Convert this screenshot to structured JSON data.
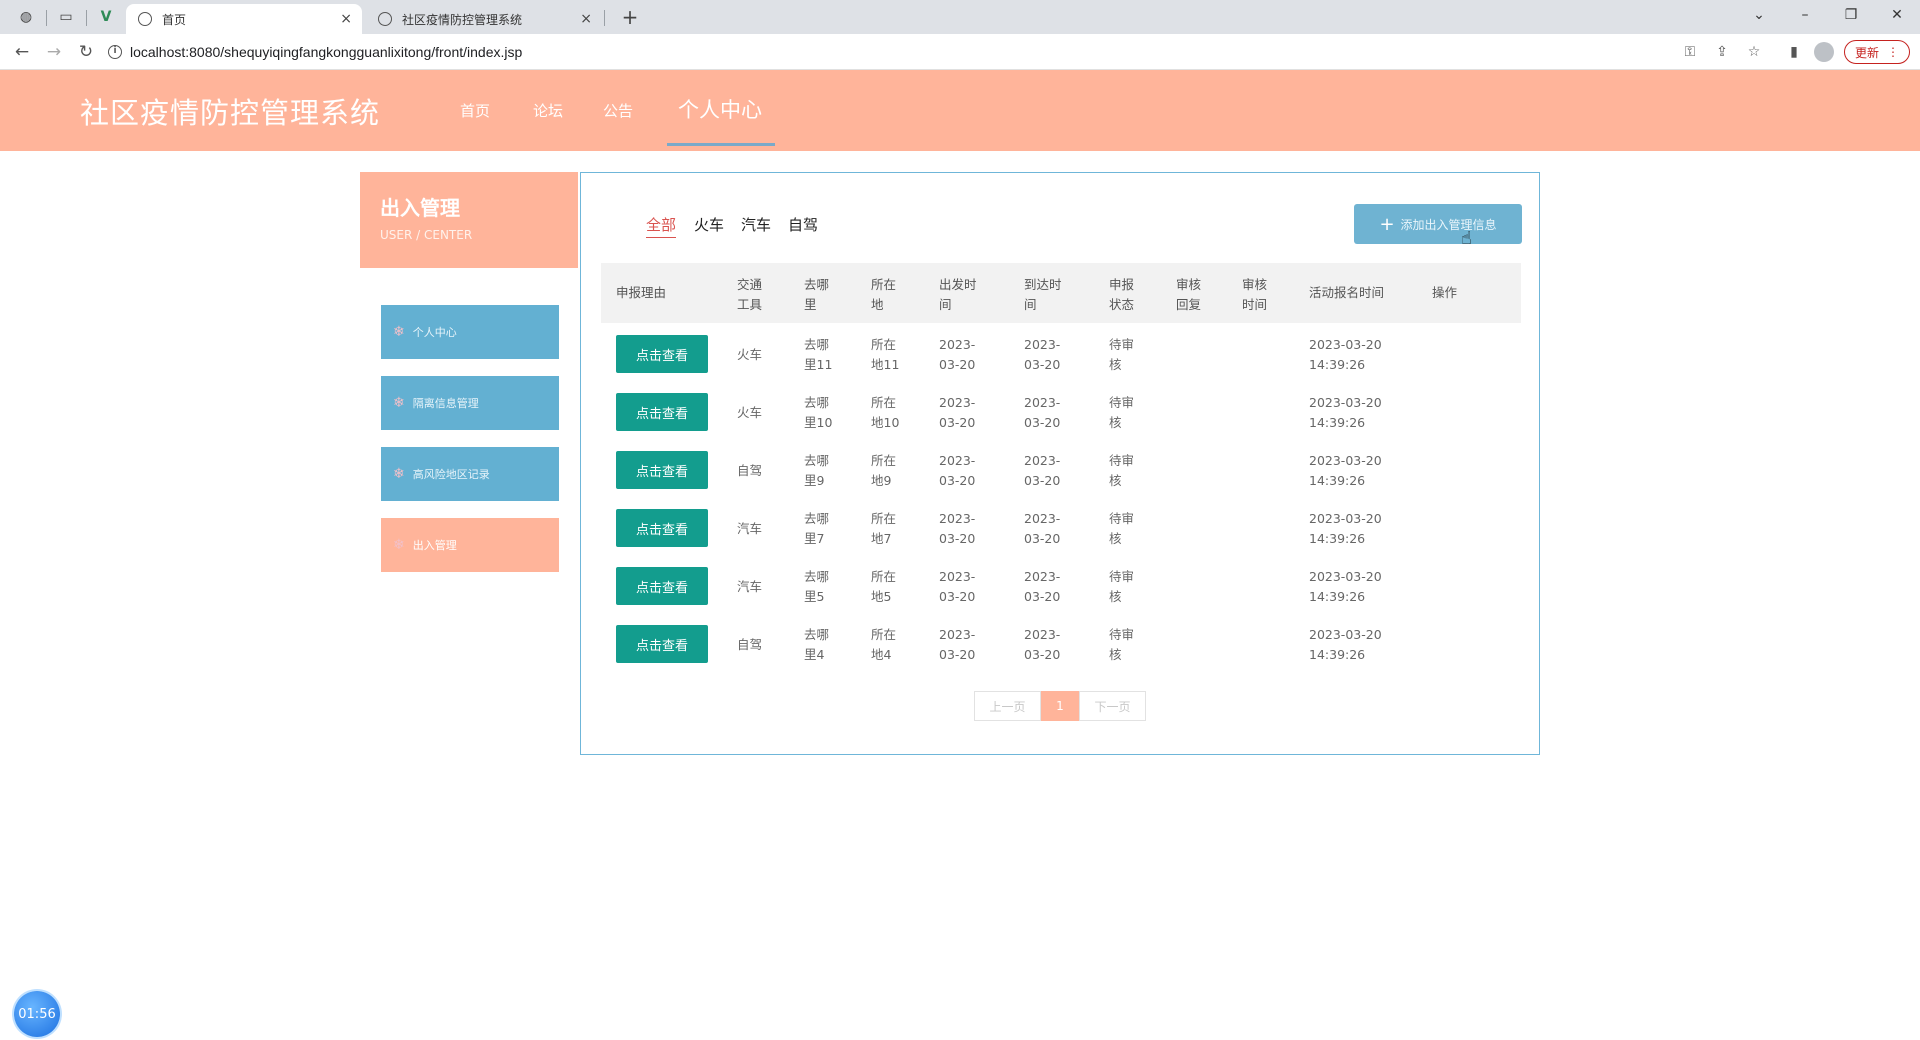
{
  "browser": {
    "tabs": [
      {
        "title": "首页",
        "close": "×"
      },
      {
        "title": "社区疫情防控管理系统",
        "close": "×"
      }
    ],
    "new_tab": "+",
    "url": "localhost:8080/shequyiqingfangkongguanlixitong/front/index.jsp",
    "update_label": "更新",
    "window_controls": {
      "dropdown": "⌄",
      "minimize": "–",
      "restore": "❐",
      "close": "✕"
    }
  },
  "header": {
    "title": "社区疫情防控管理系统",
    "nav": [
      "首页",
      "论坛",
      "公告",
      "个人中心"
    ],
    "active_nav": "个人中心"
  },
  "sidebar": {
    "title": "出入管理",
    "subtitle": "USER / CENTER",
    "items": [
      {
        "label": "个人中心",
        "active": false
      },
      {
        "label": "隔离信息管理",
        "active": false
      },
      {
        "label": "高风险地区记录",
        "active": false
      },
      {
        "label": "出入管理",
        "active": true
      }
    ]
  },
  "filters": [
    "全部",
    "火车",
    "汽车",
    "自驾"
  ],
  "active_filter": "全部",
  "add_button": "添加出入管理信息",
  "table": {
    "headers": [
      "申报理由",
      "交通工具",
      "去哪里",
      "所在地",
      "出发时间",
      "到达时间",
      "申报状态",
      "审核回复",
      "审核时间",
      "活动报名时间",
      "操作"
    ],
    "rows": [
      {
        "button": "点击查看",
        "transport": "火车",
        "destination": "去哪里11",
        "location": "所在地11",
        "depart": "2023-03-20",
        "arrive": "2023-03-20",
        "status": "待审核",
        "reply": "",
        "review_time": "",
        "signup_date": "2023-03-20",
        "signup_time": "14:39:26"
      },
      {
        "button": "点击查看",
        "transport": "火车",
        "destination": "去哪里10",
        "location": "所在地10",
        "depart": "2023-03-20",
        "arrive": "2023-03-20",
        "status": "待审核",
        "reply": "",
        "review_time": "",
        "signup_date": "2023-03-20",
        "signup_time": "14:39:26"
      },
      {
        "button": "点击查看",
        "transport": "自驾",
        "destination": "去哪里9",
        "location": "所在地9",
        "depart": "2023-03-20",
        "arrive": "2023-03-20",
        "status": "待审核",
        "reply": "",
        "review_time": "",
        "signup_date": "2023-03-20",
        "signup_time": "14:39:26"
      },
      {
        "button": "点击查看",
        "transport": "汽车",
        "destination": "去哪里7",
        "location": "所在地7",
        "depart": "2023-03-20",
        "arrive": "2023-03-20",
        "status": "待审核",
        "reply": "",
        "review_time": "",
        "signup_date": "2023-03-20",
        "signup_time": "14:39:26"
      },
      {
        "button": "点击查看",
        "transport": "汽车",
        "destination": "去哪里5",
        "location": "所在地5",
        "depart": "2023-03-20",
        "arrive": "2023-03-20",
        "status": "待审核",
        "reply": "",
        "review_time": "",
        "signup_date": "2023-03-20",
        "signup_time": "14:39:26"
      },
      {
        "button": "点击查看",
        "transport": "自驾",
        "destination": "去哪里4",
        "location": "所在地4",
        "depart": "2023-03-20",
        "arrive": "2023-03-20",
        "status": "待审核",
        "reply": "",
        "review_time": "",
        "signup_date": "2023-03-20",
        "signup_time": "14:39:26"
      }
    ]
  },
  "pagination": {
    "prev": "上一页",
    "current": "1",
    "next": "下一页"
  },
  "timer": "01:56",
  "colors": {
    "header": "#ffb49a",
    "sidebar_item": "#63b0d2",
    "view_button": "#139d8e",
    "panel_border": "#6fb6d9"
  }
}
